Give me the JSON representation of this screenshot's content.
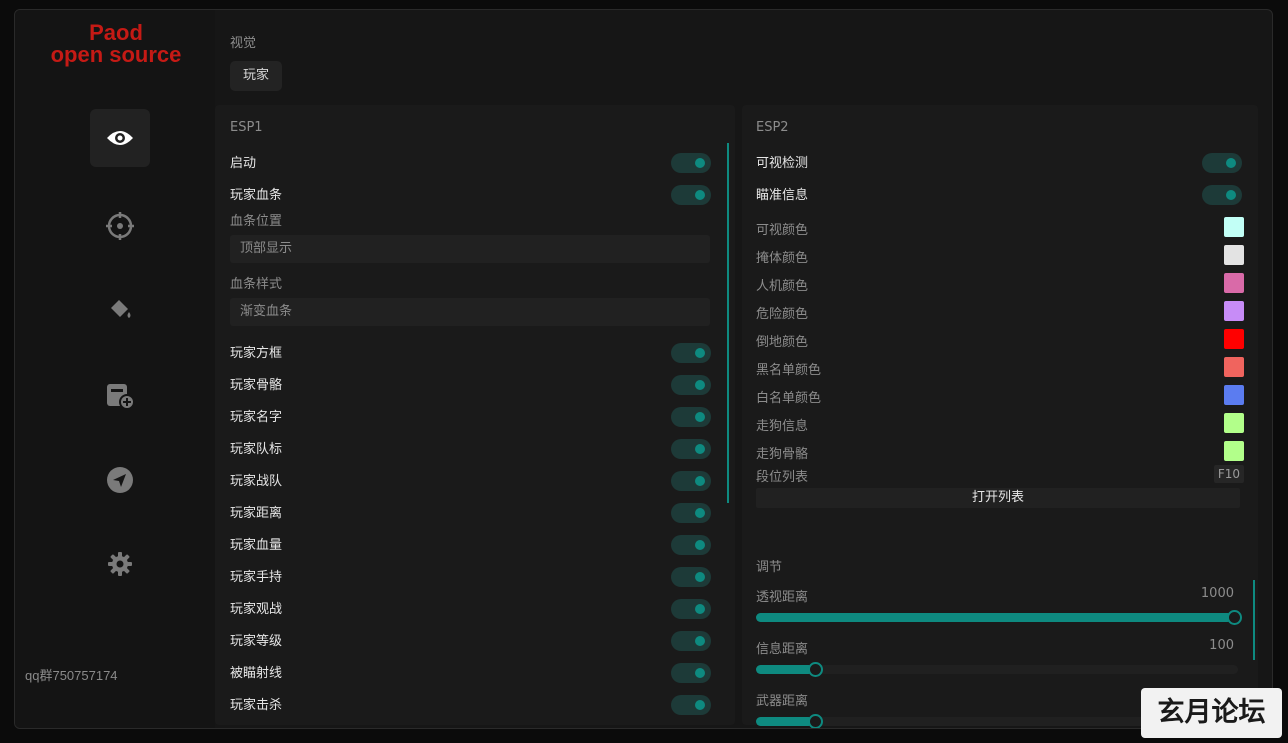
{
  "brand": {
    "line1": "Paod",
    "line2": "open source"
  },
  "sidebar": {
    "items": [
      {
        "icon": "eye-icon",
        "active": true
      },
      {
        "icon": "crosshair-icon",
        "active": false
      },
      {
        "icon": "paint-bucket-icon",
        "active": false
      },
      {
        "icon": "package-add-icon",
        "active": false
      },
      {
        "icon": "send-icon",
        "active": false
      },
      {
        "icon": "gear-icon",
        "active": false
      }
    ],
    "footer": "qq群750757174"
  },
  "header": {
    "section": "视觉",
    "tab": "玩家"
  },
  "esp1": {
    "title": "ESP1",
    "top_toggles": [
      {
        "label": "启动",
        "on": true
      },
      {
        "label": "玩家血条",
        "on": true
      }
    ],
    "bar_position": {
      "label": "血条位置",
      "value": "顶部显示"
    },
    "bar_style": {
      "label": "血条样式",
      "value": "渐变血条"
    },
    "toggles": [
      {
        "label": "玩家方框",
        "on": true
      },
      {
        "label": "玩家骨骼",
        "on": true
      },
      {
        "label": "玩家名字",
        "on": true
      },
      {
        "label": "玩家队标",
        "on": true
      },
      {
        "label": "玩家战队",
        "on": true
      },
      {
        "label": "玩家距离",
        "on": true
      },
      {
        "label": "玩家血量",
        "on": true
      },
      {
        "label": "玩家手持",
        "on": true
      },
      {
        "label": "玩家观战",
        "on": true
      },
      {
        "label": "玩家等级",
        "on": true
      },
      {
        "label": "被瞄射线",
        "on": true
      },
      {
        "label": "玩家击杀",
        "on": true
      }
    ]
  },
  "esp2": {
    "title": "ESP2",
    "toggles": [
      {
        "label": "可视检测",
        "on": true
      },
      {
        "label": "瞄准信息",
        "on": true
      }
    ],
    "colors": [
      {
        "label": "可视颜色",
        "color": "#c2fff6"
      },
      {
        "label": "掩体颜色",
        "color": "#e3e3e3"
      },
      {
        "label": "人机颜色",
        "color": "#d96aa8"
      },
      {
        "label": "危险颜色",
        "color": "#c78cf7"
      },
      {
        "label": "倒地颜色",
        "color": "#ff0000"
      },
      {
        "label": "黑名单颜色",
        "color": "#f0645e"
      },
      {
        "label": "白名单颜色",
        "color": "#5b7cf0"
      },
      {
        "label": "走狗信息",
        "color": "#b2ff8a"
      },
      {
        "label": "走狗骨骼",
        "color": "#b2ff8a"
      }
    ],
    "rank_list": {
      "label": "段位列表",
      "key": "F10",
      "button": "打开列表"
    }
  },
  "adjust": {
    "title": "调节",
    "sliders": [
      {
        "label": "透视距离",
        "value": "1000",
        "fraction": 1.0
      },
      {
        "label": "信息距离",
        "value": "100",
        "fraction": 0.11
      },
      {
        "label": "武器距离",
        "value": "",
        "fraction": 0.11
      }
    ]
  },
  "watermark": "玄月论坛",
  "colors": {
    "accent": "#0e8a80",
    "brand": "#c51a15",
    "background": "#161616"
  }
}
